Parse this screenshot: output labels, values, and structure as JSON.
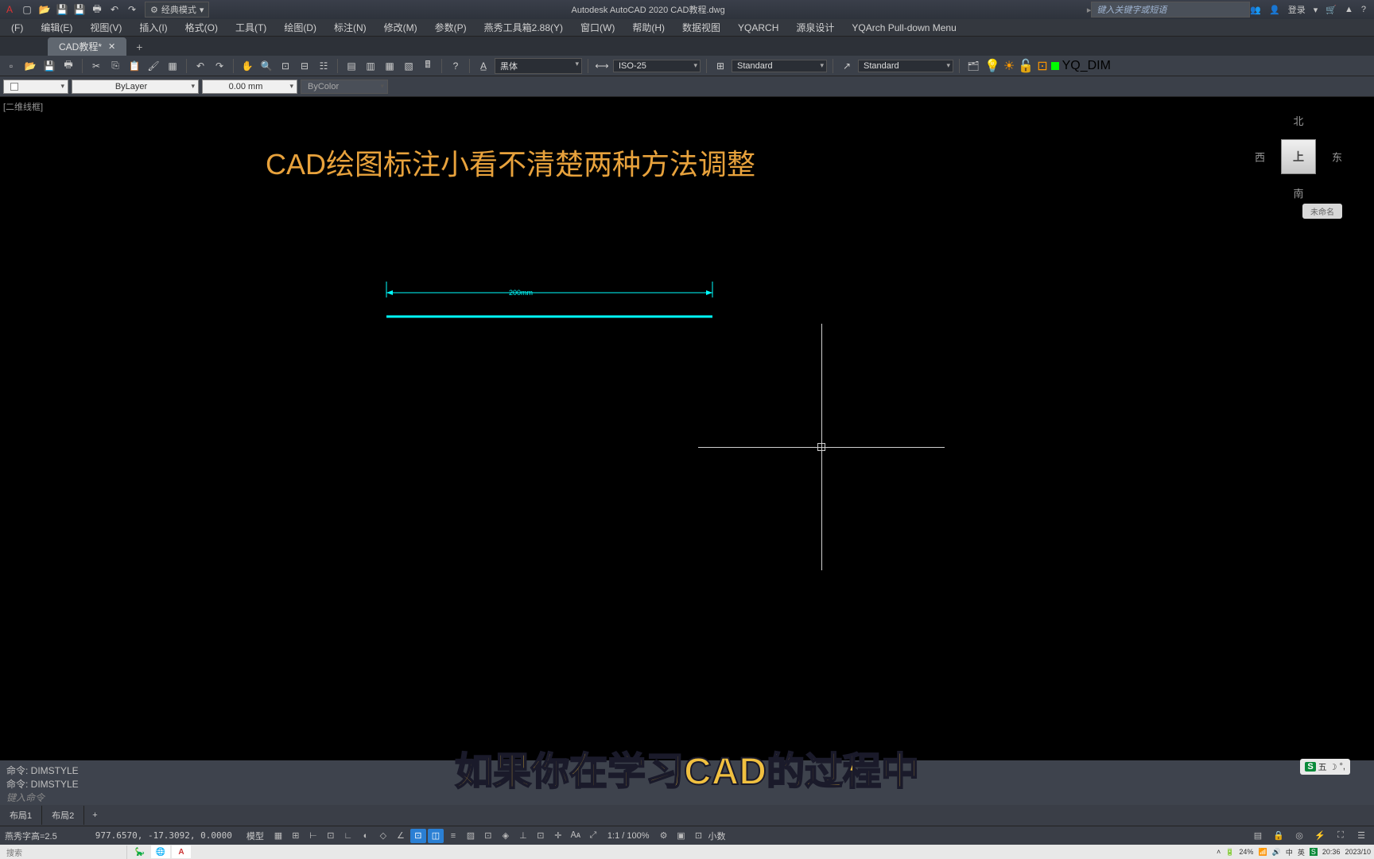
{
  "titlebar": {
    "workspace": "经典模式",
    "app_title": "Autodesk AutoCAD 2020   CAD教程.dwg",
    "search_placeholder": "键入关键字或短语",
    "login": "登录"
  },
  "menu": {
    "items": [
      "(F)",
      "编辑(E)",
      "视图(V)",
      "插入(I)",
      "格式(O)",
      "工具(T)",
      "绘图(D)",
      "标注(N)",
      "修改(M)",
      "参数(P)",
      "燕秀工具箱2.88(Y)",
      "窗口(W)",
      "帮助(H)",
      "数据视图",
      "YQARCH",
      "源泉设计",
      "YQArch Pull-down Menu"
    ]
  },
  "doctab": {
    "name": "CAD教程*",
    "add": "+"
  },
  "tb1": {
    "font": "黑体",
    "dimstyle": "ISO-25",
    "textstyle1": "Standard",
    "textstyle2": "Standard",
    "layer_label": "YQ_DIM"
  },
  "tb2": {
    "layer": "ByLayer",
    "lw": "0.00 mm",
    "bycolor": "ByColor"
  },
  "canvas": {
    "tl": "[二维线框]",
    "headline": "CAD绘图标注小看不清楚两种方法调整",
    "dim_value": "200mm",
    "vc_n": "北",
    "vc_s": "南",
    "vc_e": "东",
    "vc_w": "西",
    "vc_top": "上",
    "vc_label": "未命名",
    "min": "—",
    "x": "✕"
  },
  "cmd": {
    "hist1": "命令: DIMSTYLE",
    "hist2": "命令: DIMSTYLE",
    "prompt": "键入命令"
  },
  "subtitle": "如果你在学习CAD的过程中",
  "layouts": {
    "tab1": "布局1",
    "tab2": "布局2",
    "add": "+"
  },
  "status": {
    "yx_text": "燕秀字高=2.5",
    "coords": "977.6570, -17.3092, 0.0000",
    "model": "模型",
    "scale": "1:1 / 100%",
    "dec": "小数"
  },
  "taskbar": {
    "search": "搜索",
    "battery": "24%",
    "ime_zh": "中",
    "ime_en": "英",
    "time": "20:36",
    "date": "2023/10"
  },
  "ime": {
    "s": "S",
    "txt": "五",
    "moon": "☽"
  }
}
